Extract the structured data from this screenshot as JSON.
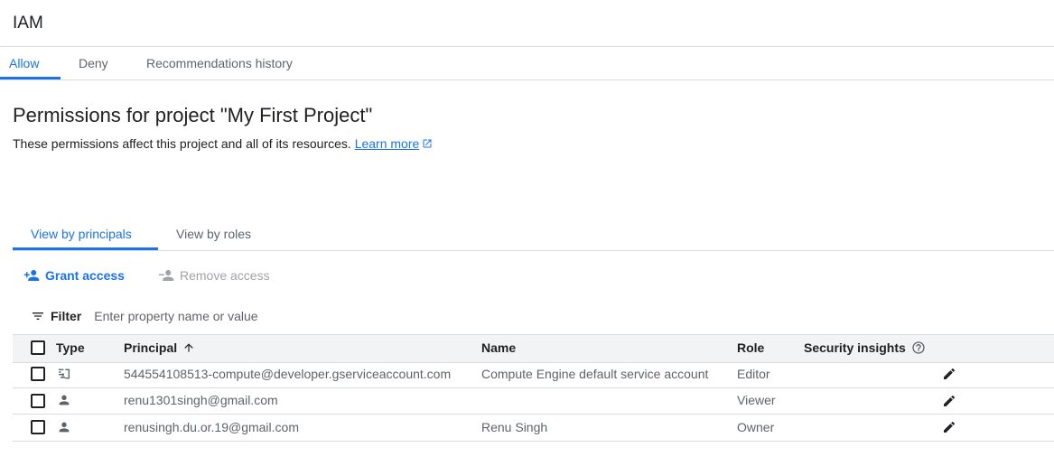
{
  "header": {
    "title": "IAM"
  },
  "tabs": [
    {
      "label": "Allow",
      "active": true
    },
    {
      "label": "Deny",
      "active": false
    },
    {
      "label": "Recommendations history",
      "active": false
    }
  ],
  "page": {
    "heading": "Permissions for project \"My First Project\"",
    "description": "These permissions affect this project and all of its resources.",
    "learn_more": "Learn more"
  },
  "view_tabs": [
    {
      "label": "View by principals",
      "active": true
    },
    {
      "label": "View by roles",
      "active": false
    }
  ],
  "actions": {
    "grant": "Grant access",
    "remove": "Remove access"
  },
  "filter": {
    "label": "Filter",
    "placeholder": "Enter property name or value"
  },
  "table": {
    "columns": {
      "type": "Type",
      "principal": "Principal",
      "name": "Name",
      "role": "Role",
      "security": "Security insights"
    },
    "sort": {
      "column": "principal",
      "direction": "ascending"
    },
    "rows": [
      {
        "type_icon": "service-account-icon",
        "principal": "544554108513-compute@developer.gserviceaccount.com",
        "name": "Compute Engine default service account",
        "role": "Editor"
      },
      {
        "type_icon": "person-icon",
        "principal": "renu1301singh@gmail.com",
        "name": "",
        "role": "Viewer"
      },
      {
        "type_icon": "person-icon",
        "principal": "renusingh.du.or.19@gmail.com",
        "name": "Renu Singh",
        "role": "Owner"
      }
    ]
  },
  "colors": {
    "accent": "#1a73e8",
    "text": "#202124",
    "muted": "#5f6368",
    "divider": "#dadce0",
    "header_bg": "#f1f3f4"
  }
}
